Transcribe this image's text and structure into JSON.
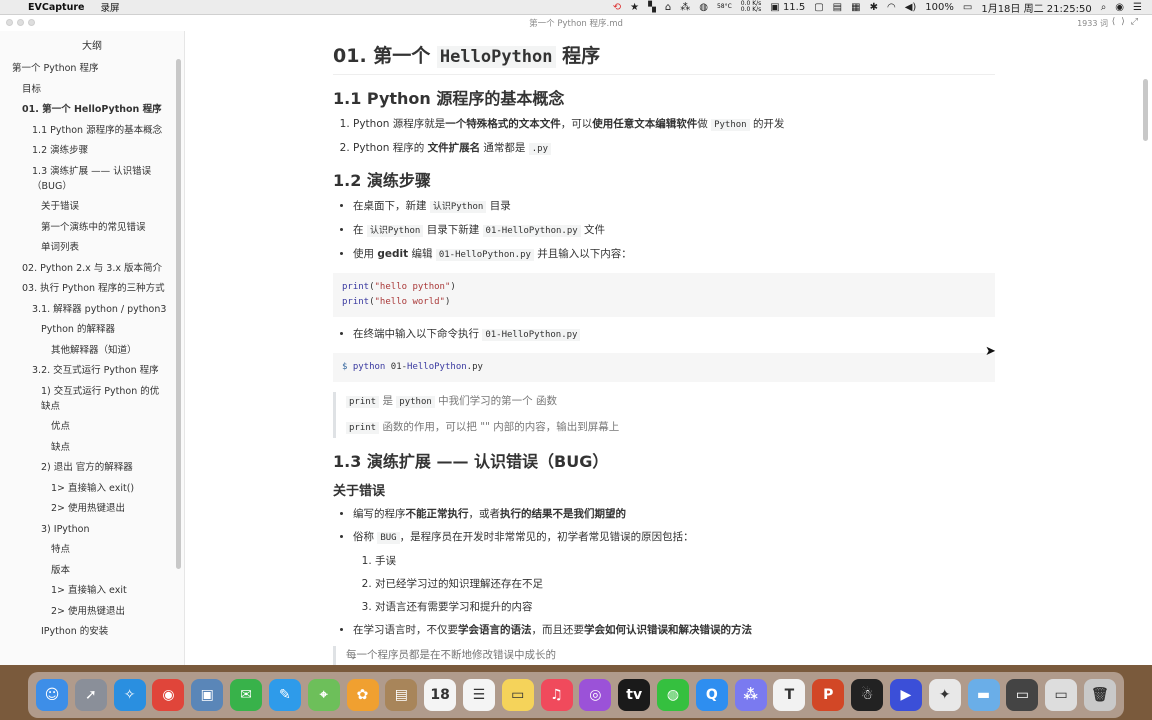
{
  "menubar": {
    "app_name": "EVCapture",
    "menu": "录屏",
    "temp": "58°C",
    "cpu": "11.5",
    "net_up": "0.0 K/s",
    "net_down": "0.0 K/s",
    "battery": "100%",
    "datetime": "1月18日 周二  21:25:50"
  },
  "window": {
    "title": "第一个 Python 程序.md",
    "word_count": "1933 词"
  },
  "sidebar": {
    "title": "大纲",
    "items": [
      {
        "label": "第一个 Python 程序",
        "level": 1
      },
      {
        "label": "目标",
        "level": 2
      },
      {
        "label": "01. 第一个 HelloPython 程序",
        "level": 2
      },
      {
        "label": "1.1 Python 源程序的基本概念",
        "level": 3
      },
      {
        "label": "1.2 演练步骤",
        "level": 3
      },
      {
        "label": "1.3 演练扩展 —— 认识错误（BUG）",
        "level": 3
      },
      {
        "label": "关于错误",
        "level": 4
      },
      {
        "label": "第一个演练中的常见错误",
        "level": 4
      },
      {
        "label": "单词列表",
        "level": 4
      },
      {
        "label": "02. Python 2.x 与 3.x 版本简介",
        "level": 2
      },
      {
        "label": "03. 执行 Python 程序的三种方式",
        "level": 2
      },
      {
        "label": "3.1. 解释器 python / python3",
        "level": 3
      },
      {
        "label": "Python 的解释器",
        "level": 4
      },
      {
        "label": "其他解释器（知道）",
        "level": 5
      },
      {
        "label": "3.2. 交互式运行 Python 程序",
        "level": 3
      },
      {
        "label": "1) 交互式运行 Python 的优缺点",
        "level": 4
      },
      {
        "label": "优点",
        "level": 5
      },
      {
        "label": "缺点",
        "level": 5
      },
      {
        "label": "2) 退出 官方的解释器",
        "level": 4
      },
      {
        "label": "1> 直接输入 exit()",
        "level": 5
      },
      {
        "label": "2> 使用热键退出",
        "level": 5
      },
      {
        "label": "3) IPython",
        "level": 4
      },
      {
        "label": "特点",
        "level": 5
      },
      {
        "label": "版本",
        "level": 5
      },
      {
        "label": "1> 直接输入 exit",
        "level": 5
      },
      {
        "label": "2> 使用热键退出",
        "level": 5
      },
      {
        "label": "IPython 的安装",
        "level": 4
      }
    ]
  },
  "doc": {
    "h1_pre": "01. 第一个",
    "h1_code": "HelloPython",
    "h1_post": "程序",
    "s11_title": "1.1 Python 源程序的基本概念",
    "s11_li1_a": "Python 源程序就是",
    "s11_li1_b": "一个特殊格式的文本文件",
    "s11_li1_c": "，可以",
    "s11_li1_d": "使用任意文本编辑软件",
    "s11_li1_e": "做",
    "s11_li1_code": "Python",
    "s11_li1_f": "的开发",
    "s11_li2_a": "Python 程序的",
    "s11_li2_b": "文件扩展名",
    "s11_li2_c": "通常都是",
    "s11_li2_code": ".py",
    "s12_title": "1.2 演练步骤",
    "s12_li1_a": "在桌面下，新建",
    "s12_li1_code": "认识Python",
    "s12_li1_b": "目录",
    "s12_li2_a": "在",
    "s12_li2_code1": "认识Python",
    "s12_li2_b": "目录下新建",
    "s12_li2_code2": "01-HelloPython.py",
    "s12_li2_c": "文件",
    "s12_li3_a": "使用",
    "s12_li3_b": "gedit",
    "s12_li3_c": "编辑",
    "s12_li3_code": "01-HelloPython.py",
    "s12_li3_d": "并且输入以下内容：",
    "code1_fn": "print",
    "code1_s1": "\"hello python\"",
    "code1_s2": "\"hello world\"",
    "s12_li4_a": "在终端中输入以下命令执行",
    "s12_li4_code": "01-HelloPython.py",
    "code2_prompt": "$",
    "code2_cmd": "python",
    "code2_arg1": "01-",
    "code2_arg2": "HelloPython",
    "code2_arg3": ".py",
    "quote1_code1": "print",
    "quote1_a": "是",
    "quote1_code2": "python",
    "quote1_b": "中我们学习的第一个 函数",
    "quote2_code": "print",
    "quote2_a": "函数的作用，可以把 \"\" 内部的内容，输出到屏幕上",
    "s13_title": "1.3 演练扩展 —— 认识错误（BUG）",
    "about_title": "关于错误",
    "e_li1_a": "编写的程序",
    "e_li1_b": "不能正常执行",
    "e_li1_c": "，或者",
    "e_li1_d": "执行的结果不是我们期望的",
    "e_li2_a": "俗称",
    "e_li2_code": "BUG",
    "e_li2_b": "，是程序员在开发时非常常见的，初学者常见错误的原因包括：",
    "e_sub1": "手误",
    "e_sub2": "对已经学习过的知识理解还存在不足",
    "e_sub3": "对语言还有需要学习和提升的内容",
    "e_li3_a": "在学习语言时，不仅要",
    "e_li3_b": "学会语言的语法",
    "e_li3_c": "，而且还要",
    "e_li3_d": "学会如何认识错误和解决错误的方法",
    "quote3": "每一个程序员都是在不断地修改错误中成长的"
  },
  "dock": {
    "items": [
      {
        "name": "finder",
        "color": "#3d8ee8",
        "glyph": "☺"
      },
      {
        "name": "launchpad",
        "color": "#8a8f99",
        "glyph": "➚"
      },
      {
        "name": "safari",
        "color": "#2a8fe0",
        "glyph": "✧"
      },
      {
        "name": "chrome",
        "color": "#e0453a",
        "glyph": "◉"
      },
      {
        "name": "preview",
        "color": "#5a86b8",
        "glyph": "▣"
      },
      {
        "name": "wechat-work",
        "color": "#38b24a",
        "glyph": "✉"
      },
      {
        "name": "messages",
        "color": "#2e9bea",
        "glyph": "✎"
      },
      {
        "name": "maps",
        "color": "#6dbf5a",
        "glyph": "⌖"
      },
      {
        "name": "photos",
        "color": "#f0a030",
        "glyph": "✿"
      },
      {
        "name": "notes-brown",
        "color": "#a8855a",
        "glyph": "▤"
      },
      {
        "name": "calendar",
        "color": "#f4f4f4",
        "glyph": "18"
      },
      {
        "name": "reminders",
        "color": "#f4f4f4",
        "glyph": "☰"
      },
      {
        "name": "notes",
        "color": "#f5d35a",
        "glyph": "▭"
      },
      {
        "name": "music",
        "color": "#f04a5c",
        "glyph": "♫"
      },
      {
        "name": "podcasts",
        "color": "#9b52d8",
        "glyph": "◎"
      },
      {
        "name": "apple-tv",
        "color": "#1a1a1a",
        "glyph": "tv"
      },
      {
        "name": "wechat",
        "color": "#35c03f",
        "glyph": "◍"
      },
      {
        "name": "qq-browser",
        "color": "#2e8ef0",
        "glyph": "Q"
      },
      {
        "name": "typora-app",
        "color": "#7a7af0",
        "glyph": "⁂"
      },
      {
        "name": "typora",
        "color": "#f2f2f2",
        "glyph": "T"
      },
      {
        "name": "powerpoint",
        "color": "#d24726",
        "glyph": "P"
      },
      {
        "name": "qq",
        "color": "#222222",
        "glyph": "☃"
      },
      {
        "name": "screen-recorder",
        "color": "#3b4fd8",
        "glyph": "▶"
      },
      {
        "name": "evcapture",
        "color": "#e8e8e8",
        "glyph": "✦"
      },
      {
        "name": "folder",
        "color": "#6aaee8",
        "glyph": "▬"
      },
      {
        "name": "terminal-window",
        "color": "#444444",
        "glyph": "▭"
      },
      {
        "name": "screenshot",
        "color": "#dddddd",
        "glyph": "▭"
      },
      {
        "name": "trash",
        "color": "#c9c9c9",
        "glyph": "🗑"
      }
    ]
  }
}
